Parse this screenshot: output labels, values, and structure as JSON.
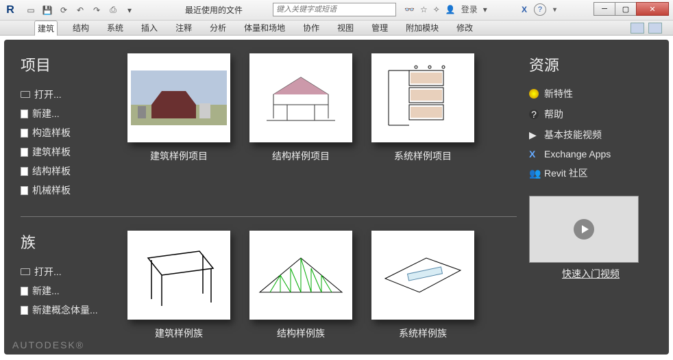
{
  "titlebar": {
    "recent_files_label": "最近使用的文件",
    "search_placeholder": "键入关键字或短语",
    "login_label": "登录"
  },
  "ribbon": {
    "tabs": [
      "建筑",
      "结构",
      "系统",
      "插入",
      "注释",
      "分析",
      "体量和场地",
      "协作",
      "视图",
      "管理",
      "附加模块",
      "修改"
    ]
  },
  "left": {
    "projects_title": "项目",
    "project_links": [
      "打开...",
      "新建...",
      "构造样板",
      "建筑样板",
      "结构样板",
      "机械样板"
    ],
    "families_title": "族",
    "family_links": [
      "打开...",
      "新建...",
      "新建概念体量..."
    ]
  },
  "thumbs": {
    "row1": [
      "建筑样例项目",
      "结构样例项目",
      "系统样例项目"
    ],
    "row2": [
      "建筑样例族",
      "结构样例族",
      "系统样例族"
    ]
  },
  "resources": {
    "title": "资源",
    "items": [
      "新特性",
      "帮助",
      "基本技能视频",
      "Exchange Apps",
      "Revit 社区"
    ],
    "video_label": "快速入门视频"
  },
  "footer": "AUTODESK®"
}
